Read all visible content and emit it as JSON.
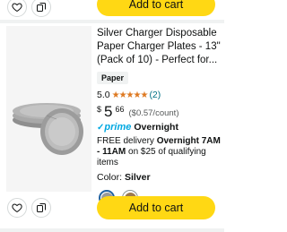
{
  "top_row": {
    "add_to_cart_label": "Add to cart"
  },
  "product": {
    "title": "Silver Charger Disposable Paper Charger Plates - 13\" (Pack of 10) - Perfect for...",
    "material_badge": "Paper",
    "rating_value": "5.0",
    "stars": "★★★★★",
    "rating_count": "(2)",
    "price_symbol": "$",
    "price_whole": "5",
    "price_fraction": "66",
    "unit_price": "($0.57/count)",
    "prime_check": "✓",
    "prime_word": "prime",
    "prime_speed": "Overnight",
    "delivery_prefix": "FREE delivery ",
    "delivery_window": "Overnight 7AM - 11AM",
    "delivery_suffix": " on $25 of qualifying items",
    "color_label": "Color:",
    "color_value": "Silver",
    "swatches": [
      {
        "name": "Silver",
        "color": "#9a9a9a",
        "selected": true
      },
      {
        "name": "Gold",
        "color": "#9c7a4f",
        "selected": false
      }
    ],
    "add_to_cart_label": "Add to cart"
  },
  "colors": {
    "accent_yellow": "#ffd814",
    "prime_blue": "#00a8e1",
    "star_orange": "#de7921",
    "link_teal": "#007185"
  }
}
